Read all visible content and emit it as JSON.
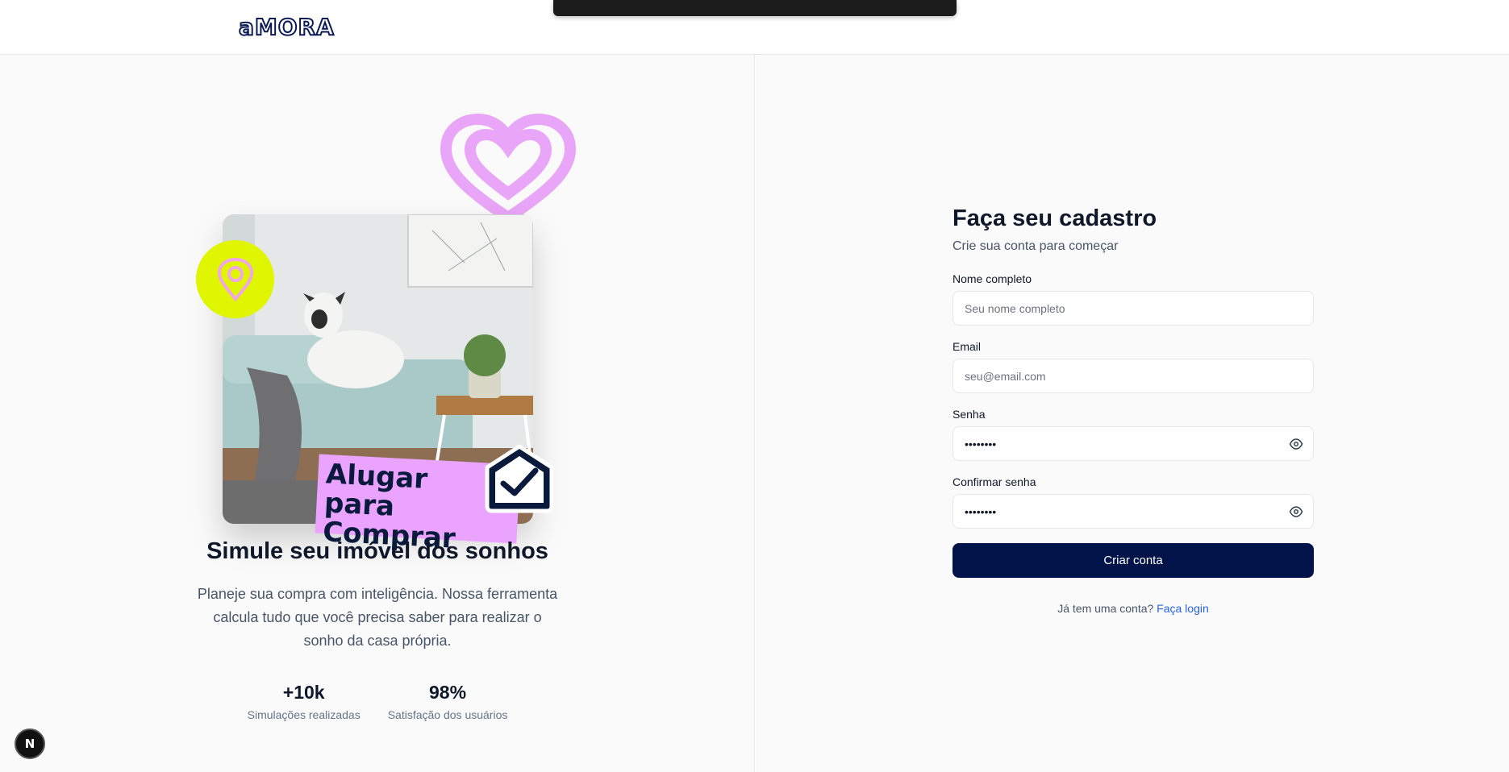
{
  "header": {
    "logo_text": "aMORA"
  },
  "hero": {
    "tag_line1": "Alugar para",
    "tag_line2": "Comprar",
    "headline": "Simule seu imóvel dos sonhos",
    "description": "Planeje sua compra com inteligência. Nossa ferramenta calcula tudo que você precisa saber para realizar o sonho da casa própria.",
    "stats": [
      {
        "value": "+10k",
        "label": "Simulações realizadas"
      },
      {
        "value": "98%",
        "label": "Satisfação dos usuários"
      }
    ]
  },
  "form": {
    "title": "Faça seu cadastro",
    "subtitle": "Crie sua conta para começar",
    "name_label": "Nome completo",
    "name_placeholder": "Seu nome completo",
    "email_label": "Email",
    "email_placeholder": "seu@email.com",
    "password_label": "Senha",
    "password_value": "••••••••",
    "confirm_label": "Confirmar senha",
    "confirm_value": "••••••••",
    "submit_label": "Criar conta",
    "login_prompt": "Já tem uma conta?",
    "login_link": "Faça login"
  },
  "badge": {
    "letter": "N"
  },
  "colors": {
    "brand_navy": "#02134a",
    "accent_lime": "#e0f500",
    "accent_pink": "#eaa3ff",
    "link_blue": "#2563eb"
  },
  "icons": [
    "map-pin-icon",
    "heart-icon",
    "house-check-icon",
    "eye-icon"
  ]
}
